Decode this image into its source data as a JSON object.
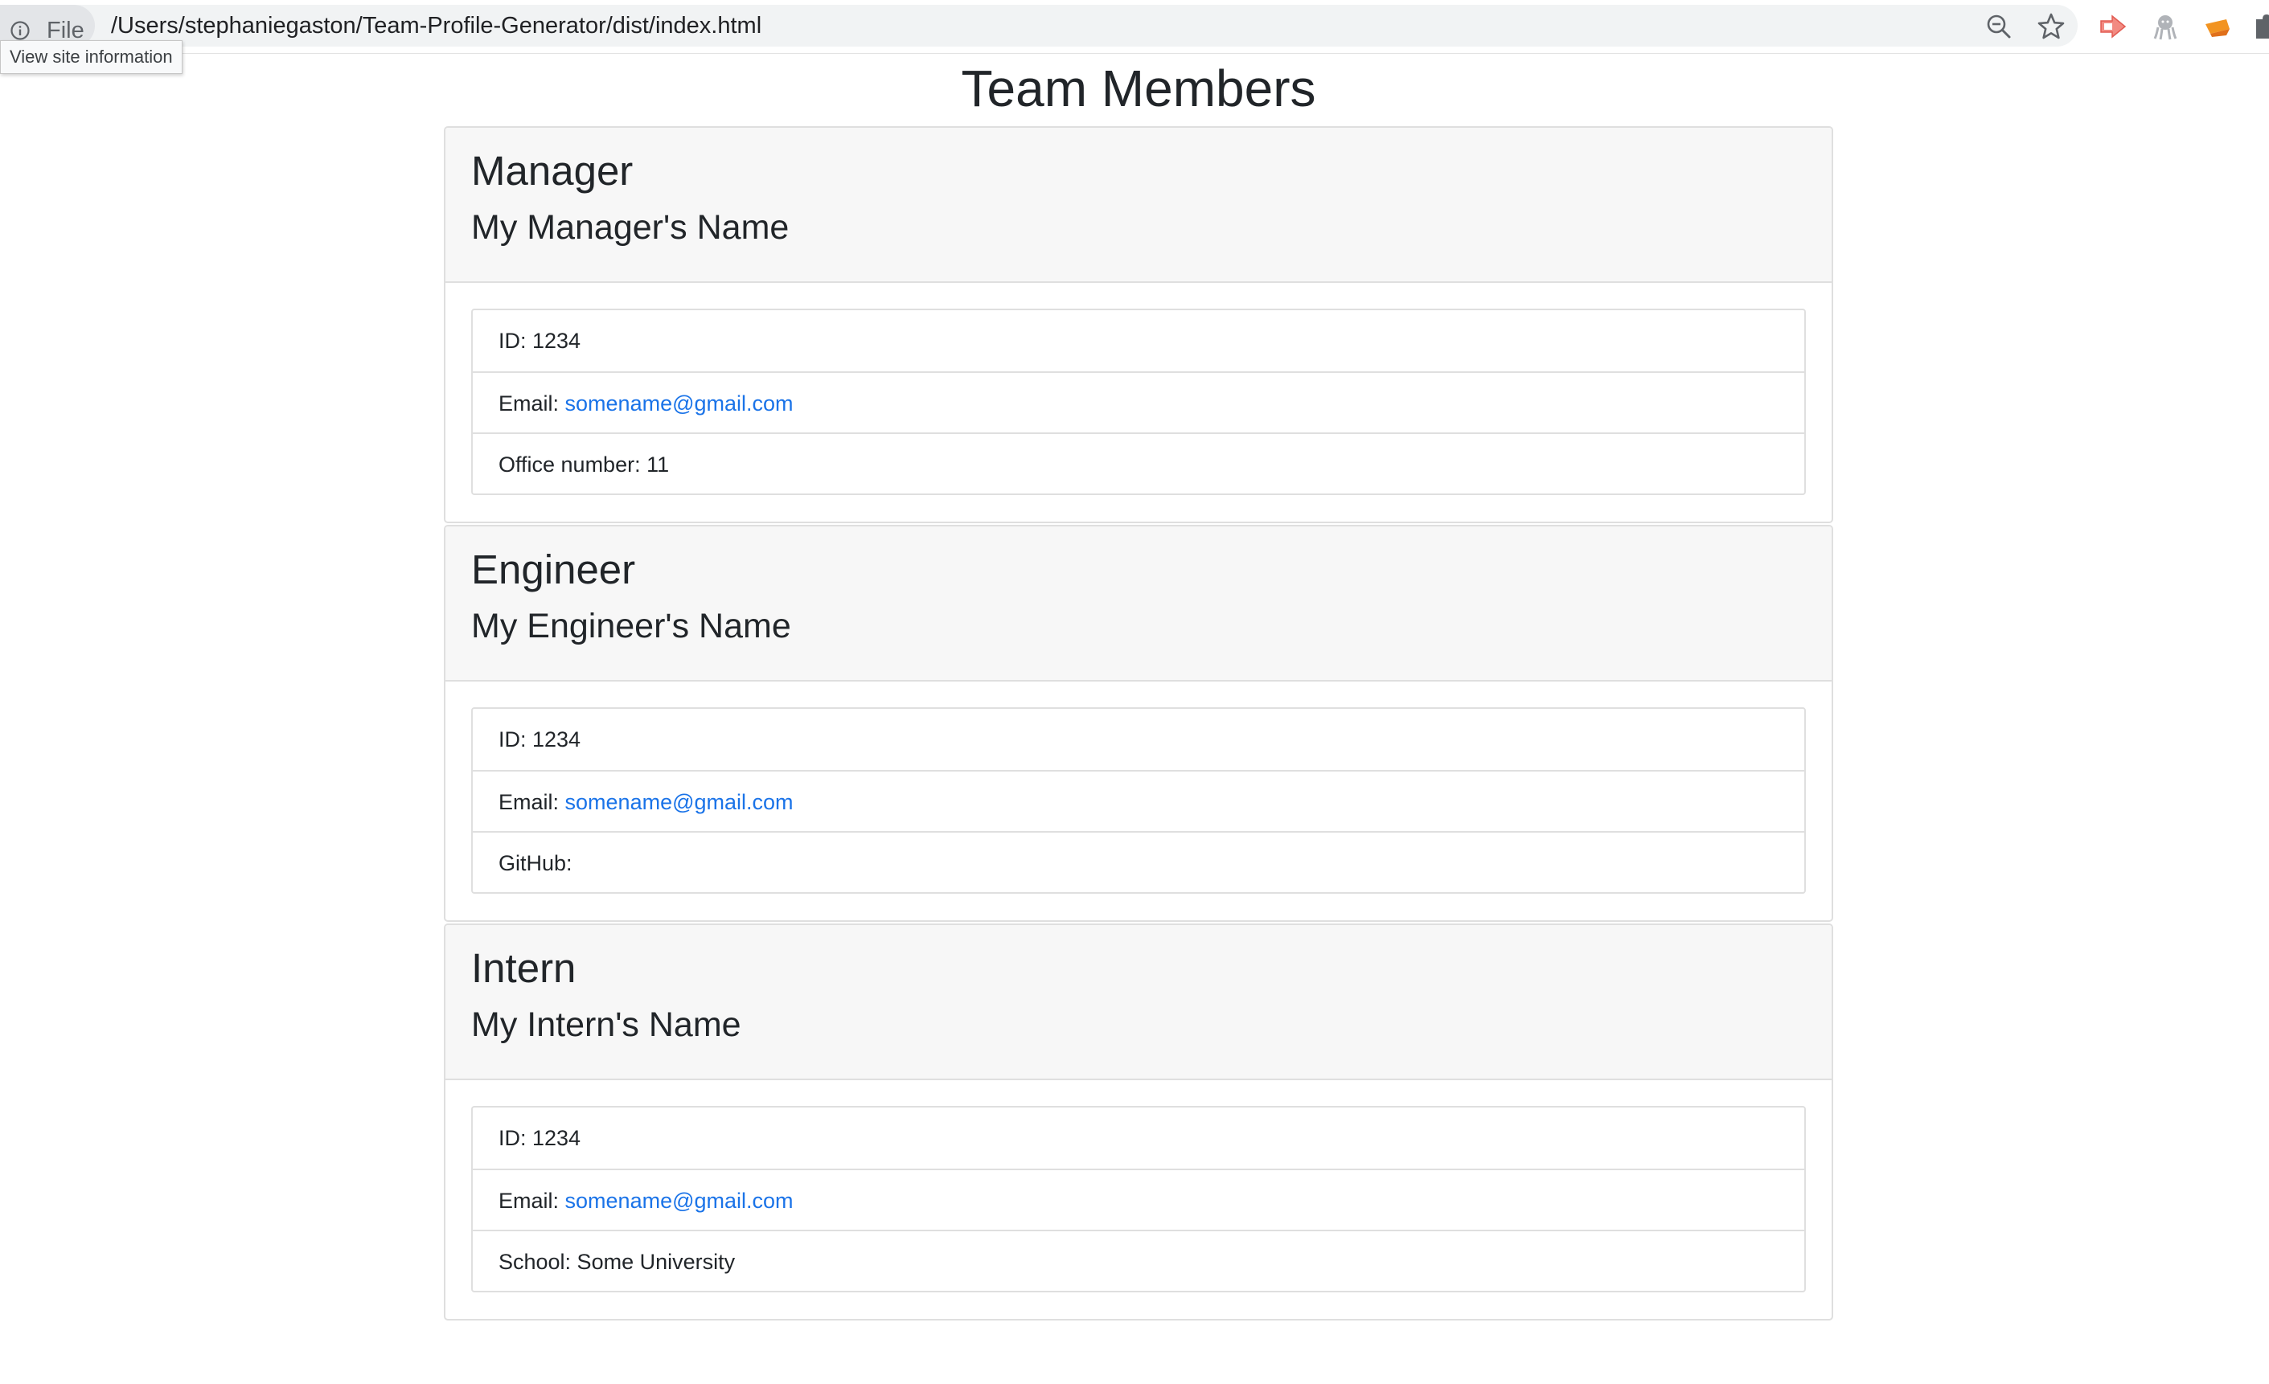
{
  "browser": {
    "site_info_chip": "File",
    "url": "/Users/stephaniegaston/Team-Profile-Generator/dist/index.html",
    "tooltip": "View site information",
    "icons": [
      "info-icon",
      "zoom-icon",
      "star-icon",
      "extension-arrow-icon",
      "extension-octopus-icon",
      "extension-orange-icon",
      "puzzle-icon"
    ]
  },
  "page": {
    "title": "Team Members"
  },
  "cards": [
    {
      "role": "Manager",
      "name": "My Manager's Name",
      "id_text": "ID: 1234",
      "email_label": "Email: ",
      "email": "somename@gmail.com",
      "extra": "Office number: 11"
    },
    {
      "role": "Engineer",
      "name": "My Engineer's Name",
      "id_text": "ID: 1234",
      "email_label": "Email: ",
      "email": "somename@gmail.com",
      "extra": "GitHub:"
    },
    {
      "role": "Intern",
      "name": "My Intern's Name",
      "id_text": "ID: 1234",
      "email_label": "Email: ",
      "email": "somename@gmail.com",
      "extra": "School: Some University"
    }
  ],
  "colors": {
    "link": "#1a73e8",
    "header_bg": "#f7f7f7",
    "border": "#dfdfdf",
    "text": "#212529"
  }
}
